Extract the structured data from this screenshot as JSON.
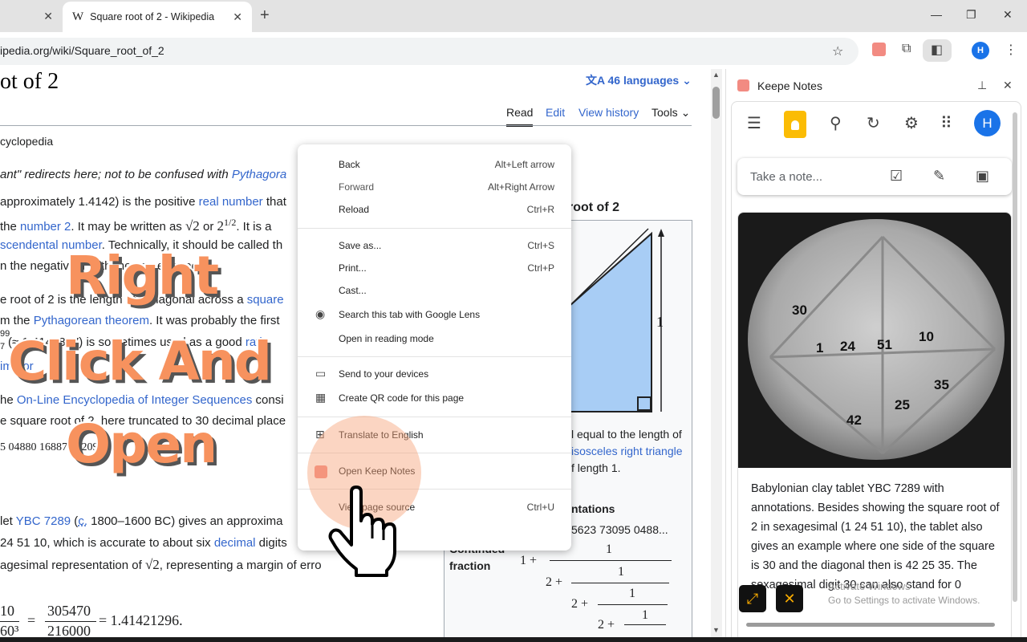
{
  "browser": {
    "inactive_tab_close": "✕",
    "active_tab": {
      "favicon": "W",
      "title": "Square root of 2 - Wikipedia",
      "close": "✕"
    },
    "new_tab": "+",
    "url": "ipedia.org/wiki/Square_root_of_2",
    "profile_initial": "H"
  },
  "wiki": {
    "title": "ot of 2",
    "languages": "46 languages",
    "tabs": {
      "read": "Read",
      "edit": "Edit",
      "history": "View history",
      "tools": "Tools"
    },
    "from": "cyclopedia",
    "hatnote_a": "ant\" redirects here; not to be confused with ",
    "hatnote_link": "Pythagora",
    "p1_a": "approximately 1.4142) is the positive ",
    "p1_link": "real number",
    "p1_b": " that",
    "p2_a": "the ",
    "p2_link": "number 2",
    "p2_b": ". It may be written as ",
    "p2_math1": "√2",
    "p2_or": " or ",
    "p2_math2": "2",
    "p2_sup": "1/2",
    "p2_c": ". It is a",
    "p3_link": "scendental number",
    "p3_b": ". Technically, it should be called th",
    "p4": "n the negativ",
    "p4_b": "ber with the same property.",
    "p5_a": "e root of 2 is the length of a diagonal across a ",
    "p5_link": "square",
    "p6_a": "m the ",
    "p6_link": "Pythagorean theorem",
    "p6_b": ". It was probably the first",
    "p7_frac_top": "99",
    "p7_frac_bot": "7",
    "p7_a": " (≈ 1.4142857) is sometimes used as a good ",
    "p7_link": "ratio",
    "p8_link": "imator",
    "p9_a": "he ",
    "p9_link": "On-Line Encyclopedia of Integer Sequences",
    "p9_b": " consi",
    "p10": "e square root of 2, here truncated to 30 decimal place",
    "p11": "5 04880 16887 24209",
    "p12_a": "let ",
    "p12_link": "YBC 7289",
    "p12_b": " (",
    "p12_c": "c.",
    "p12_d": " 1800–1600 BC) gives an approxima",
    "p13_a": "24 51 10, which is accurate to about six ",
    "p13_link": "decimal",
    "p13_b": " digits",
    "p14_a": "agesimal representation of ",
    "p14_math": "√2",
    "p14_b": ", representing a margin of erro",
    "eq_top1": "10",
    "eq_bot1": "60³",
    "eq_eq": "=",
    "eq_top2": "305470",
    "eq_bot2": "216000",
    "eq_res": "= 1.41421296.",
    "infobox": {
      "title": "root of 2",
      "side_label": "1",
      "cap1": "l equal to the length of",
      "cap2_link": "isosceles right triangle",
      "cap3": "f length 1.",
      "rep_label": "ntations",
      "rep_value": "5623 73095 0488...",
      "cf_label1": "Continued",
      "cf_label2": "fraction",
      "cf": [
        "1 +",
        "1",
        "2 +",
        "1",
        "2 +",
        "1",
        "2 +",
        "1"
      ]
    }
  },
  "overlay": {
    "line1": "Right",
    "line2": "Click And",
    "line3": "Open"
  },
  "context_menu": {
    "items": [
      {
        "label": "Back",
        "shortcut": "Alt+Left arrow"
      },
      {
        "label": "Forward",
        "shortcut": "Alt+Right Arrow"
      },
      {
        "label": "Reload",
        "shortcut": "Ctrl+R"
      },
      {
        "label": "Save as...",
        "shortcut": "Ctrl+S"
      },
      {
        "label": "Print...",
        "shortcut": "Ctrl+P"
      },
      {
        "label": "Cast...",
        "shortcut": ""
      },
      {
        "label": "Search this tab with Google Lens",
        "shortcut": ""
      },
      {
        "label": "Open in reading mode",
        "shortcut": ""
      },
      {
        "label": "Send to your devices",
        "shortcut": ""
      },
      {
        "label": "Create QR code for this page",
        "shortcut": ""
      },
      {
        "label": "Translate to English",
        "shortcut": ""
      },
      {
        "label": "Open Keep Notes",
        "shortcut": ""
      },
      {
        "label": "View page source",
        "shortcut": "Ctrl+U"
      }
    ]
  },
  "side_panel": {
    "title": "Keepe Notes",
    "profile_initial": "H",
    "take_note_placeholder": "Take a note...",
    "tablet_numbers": [
      "30",
      "1",
      "24",
      "51",
      "10",
      "35",
      "25",
      "42"
    ],
    "note_text": "Babylonian clay tablet YBC 7289 with annotations. Besides showing the square root of 2 in sexagesimal (1 24 51 10), the tablet also gives an example where one side of the square is 30 and the diagonal then is 42 25 35. The sexagesimal digit 30 can also stand for 0",
    "activate_1": "Activate Windows",
    "activate_2": "Go to Settings to activate Windows."
  },
  "colors": {
    "accent_link": "#3366cc",
    "overlay_orange": "#f7925e",
    "keep_yellow": "#fbbc04",
    "keep_red": "#f28b82"
  }
}
